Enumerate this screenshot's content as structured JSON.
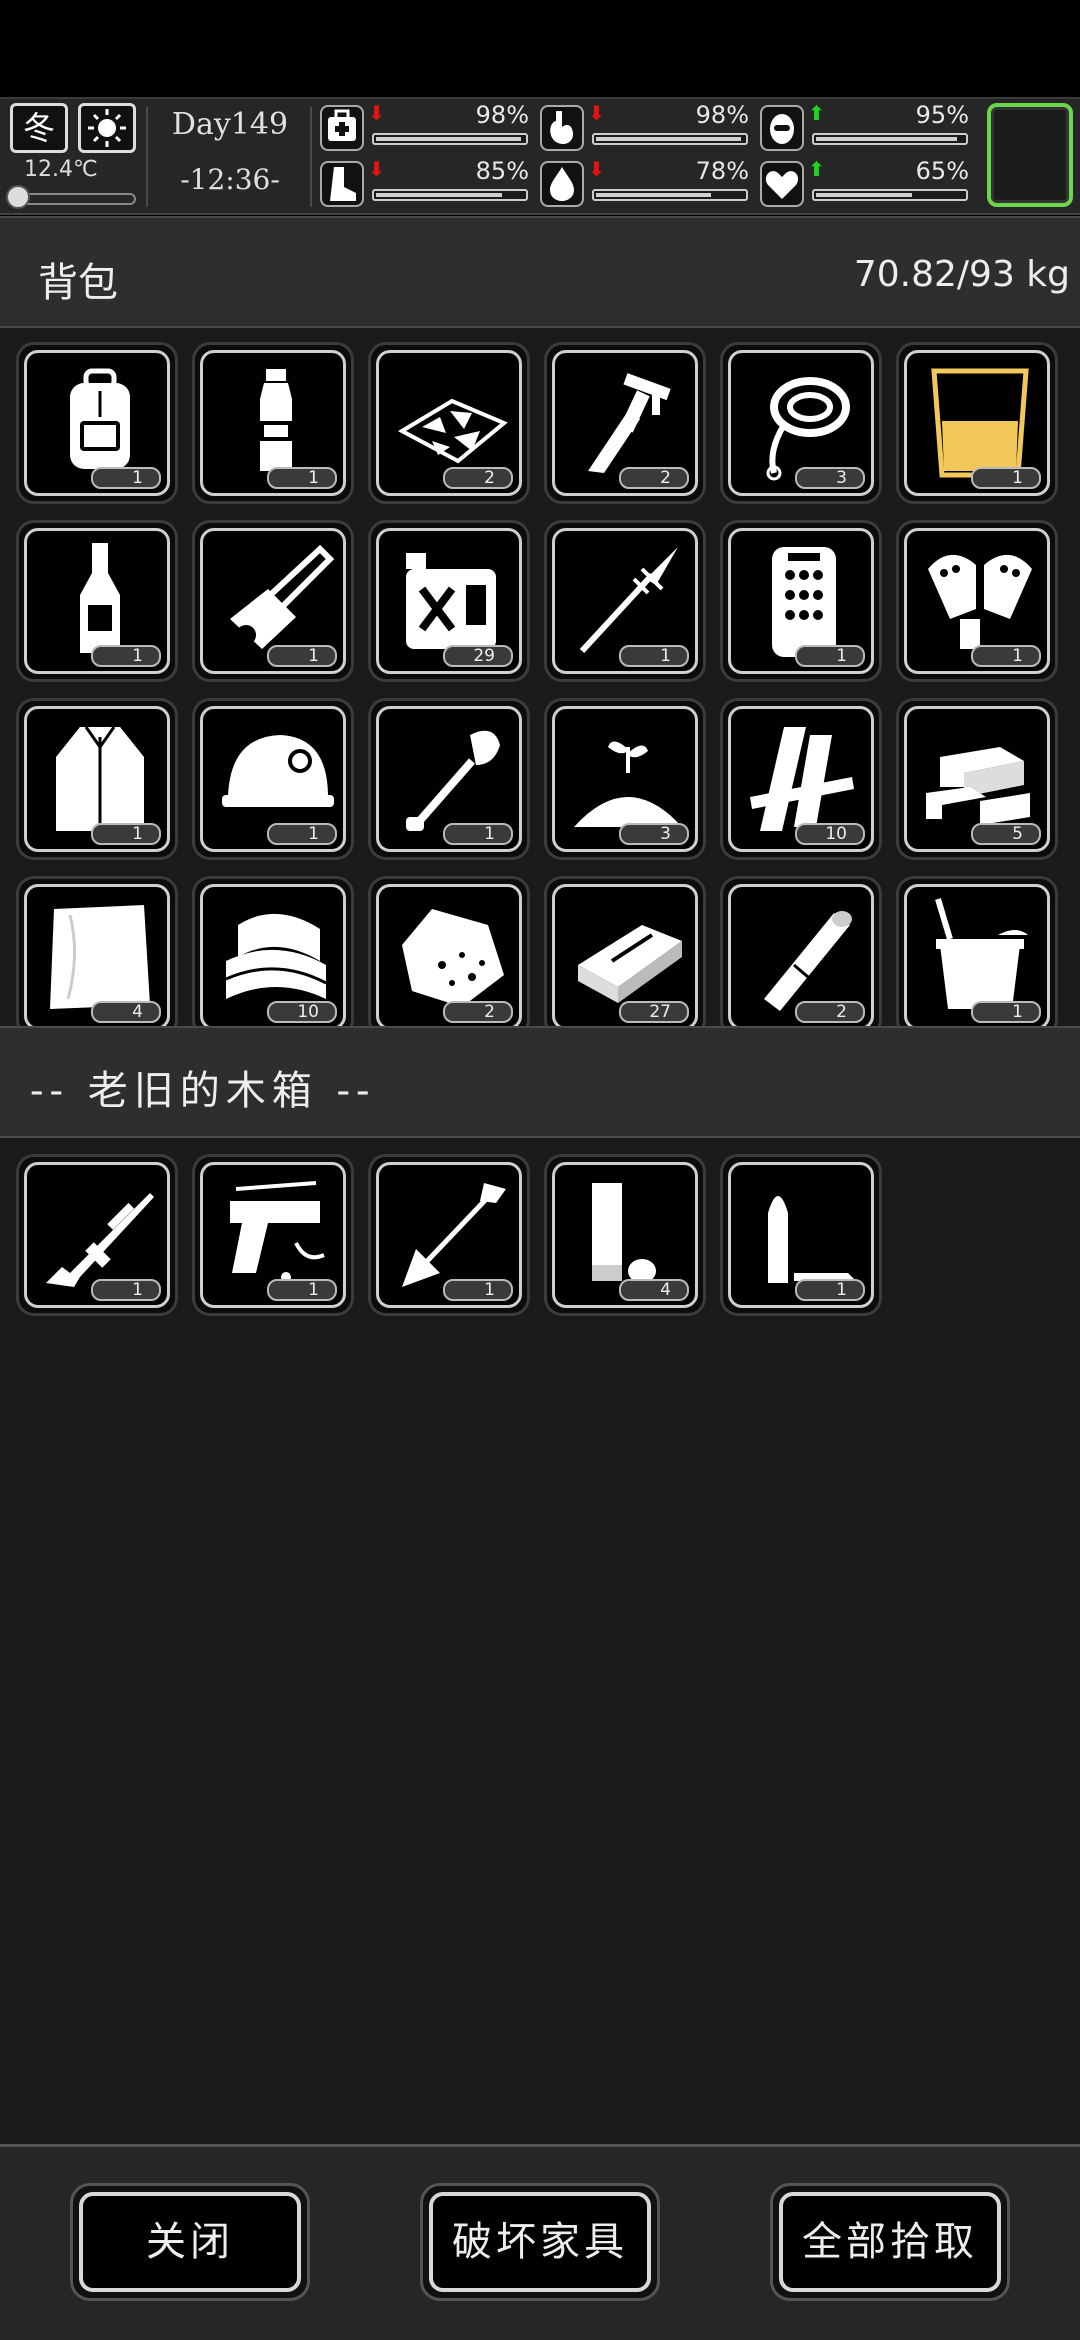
{
  "status": {
    "season": "冬",
    "weather_icon": "sun-icon",
    "temperature": "12.4℃",
    "day": "Day149",
    "time": "-12:36-",
    "stats": [
      {
        "name": "health",
        "icon": "medkit-icon",
        "trend": "down",
        "percent": "98%",
        "value": 0.98
      },
      {
        "name": "hunger",
        "icon": "stomach-icon",
        "trend": "down",
        "percent": "98%",
        "value": 0.98
      },
      {
        "name": "mood",
        "icon": "mood-icon",
        "trend": "up",
        "percent": "95%",
        "value": 0.95
      },
      {
        "name": "stamina",
        "icon": "foot-icon",
        "trend": "down",
        "percent": "85%",
        "value": 0.85
      },
      {
        "name": "thirst",
        "icon": "water-drop-icon",
        "trend": "down",
        "percent": "78%",
        "value": 0.78
      },
      {
        "name": "spirit",
        "icon": "heart-icon",
        "trend": "up",
        "percent": "65%",
        "value": 0.65
      }
    ],
    "arrow_down": "⬇",
    "arrow_up": "⬆"
  },
  "backpack": {
    "title": "背包",
    "weight": "70.82/93 kg",
    "items": [
      {
        "icon": "backpack-icon",
        "qty": "1"
      },
      {
        "icon": "water-bottle-icon",
        "qty": "1"
      },
      {
        "icon": "glass-shards-icon",
        "qty": "2"
      },
      {
        "icon": "multitool-knife-icon",
        "qty": "2"
      },
      {
        "icon": "rope-icon",
        "qty": "3"
      },
      {
        "icon": "drink-glass-icon",
        "qty": "1"
      },
      {
        "icon": "liquor-bottle-icon",
        "qty": "1"
      },
      {
        "icon": "chainsaw-icon",
        "qty": "1"
      },
      {
        "icon": "fuel-can-icon",
        "qty": "29"
      },
      {
        "icon": "spear-icon",
        "qty": "1"
      },
      {
        "icon": "armor-plate-icon",
        "qty": "1"
      },
      {
        "icon": "gloves-icon",
        "qty": "1"
      },
      {
        "icon": "jacket-icon",
        "qty": "1"
      },
      {
        "icon": "helmet-icon",
        "qty": "1"
      },
      {
        "icon": "shovel-icon",
        "qty": "1"
      },
      {
        "icon": "soil-sprout-icon",
        "qty": "3"
      },
      {
        "icon": "wood-planks-icon",
        "qty": "10"
      },
      {
        "icon": "wood-blocks-icon",
        "qty": "5"
      },
      {
        "icon": "cloth-icon",
        "qty": "4"
      },
      {
        "icon": "towels-icon",
        "qty": "10"
      },
      {
        "icon": "ore-rock-icon",
        "qty": "2"
      },
      {
        "icon": "bar-ingot-icon",
        "qty": "27"
      },
      {
        "icon": "bandage-roll-icon",
        "qty": "2"
      },
      {
        "icon": "bucket-icon",
        "qty": "1"
      }
    ]
  },
  "container": {
    "title": "-- 老旧的木箱 --",
    "items": [
      {
        "icon": "rifle-icon",
        "qty": "1"
      },
      {
        "icon": "pistol-icon",
        "qty": "1"
      },
      {
        "icon": "arrow-icon",
        "qty": "1"
      },
      {
        "icon": "shotgun-shell-icon",
        "qty": "4"
      },
      {
        "icon": "bullet-icon",
        "qty": "1"
      }
    ]
  },
  "buttons": {
    "close": "关闭",
    "destroy": "破坏家具",
    "take_all": "全部拾取"
  },
  "colors": {
    "equip_slot_border": "#6bd64a",
    "arrow_down": "#e01414",
    "arrow_up": "#20d020",
    "drink_fill": "#f3c85a"
  }
}
